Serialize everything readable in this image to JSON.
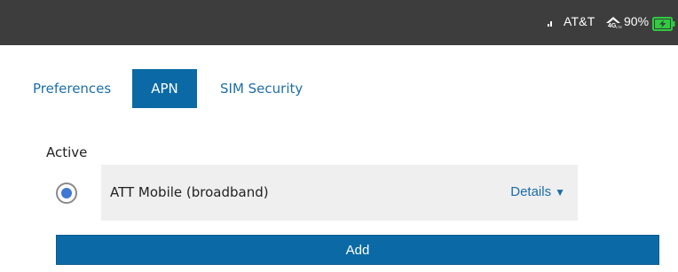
{
  "status_bar": {
    "carrier": "AT&T",
    "network_icon": "4g-lte-icon",
    "battery_percent": "90%",
    "battery_icon": "battery-charging-icon",
    "battery_color": "#2ecc40"
  },
  "tabs": [
    {
      "label": "Preferences",
      "active": false
    },
    {
      "label": "APN",
      "active": true
    },
    {
      "label": "SIM Security",
      "active": false
    }
  ],
  "active_section": {
    "label": "Active",
    "apn": {
      "name": "ATT Mobile (broadband)",
      "selected": true,
      "details_label": "Details",
      "details_icon": "▼"
    }
  },
  "add_button": {
    "label": "Add"
  },
  "colors": {
    "accent": "#0b6aa5",
    "link": "#1a6ba8",
    "status_bar_bg": "#3d3d3d",
    "row_bg": "#efefef",
    "radio_dot": "#3f79d4"
  }
}
